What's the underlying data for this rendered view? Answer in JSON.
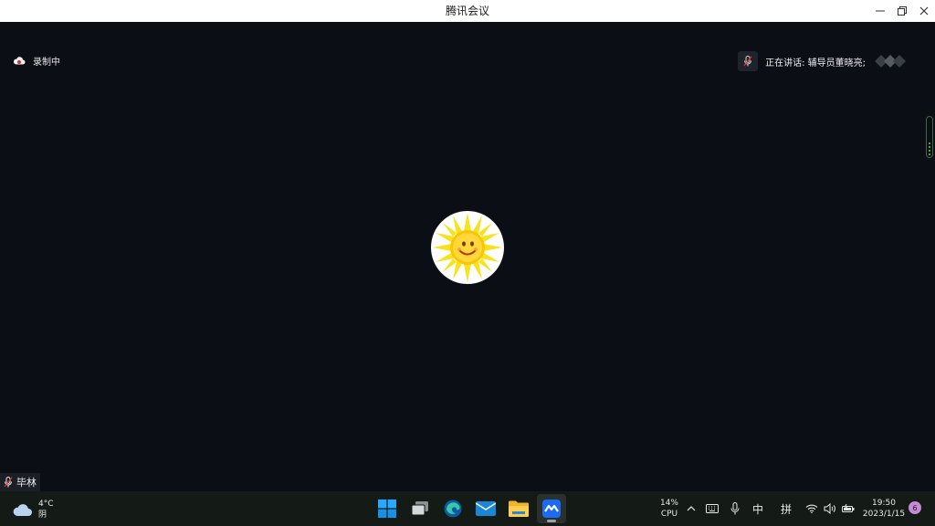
{
  "window": {
    "title": "腾讯会议"
  },
  "meeting": {
    "recording_label": "录制中",
    "speaking_label": "正在讲话: 辅导员董晓亮;",
    "participant_name": "毕林"
  },
  "taskbar": {
    "weather": {
      "temperature": "4°C",
      "condition": "阴"
    },
    "cpu": {
      "percent": "14%",
      "label": "CPU"
    },
    "ime": {
      "lang": "中",
      "mode": "拼"
    },
    "clock": {
      "time": "19:50",
      "date": "2023/1/15"
    },
    "notification_count": "6"
  },
  "colors": {
    "stage_bg": "#0b0e14",
    "taskbar_bg": "#141b17",
    "accent_blue": "#0078d4",
    "sun_yellow": "#ffd21a"
  },
  "icons": [
    "cloud-icon",
    "mic-muted-icon",
    "sun-avatar-icon",
    "windows-start-icon",
    "task-view-icon",
    "edge-icon",
    "mail-icon",
    "file-explorer-icon",
    "tencent-meeting-icon",
    "chevron-up-icon",
    "keyboard-icon",
    "mic-icon",
    "wifi-icon",
    "volume-icon",
    "battery-icon"
  ]
}
